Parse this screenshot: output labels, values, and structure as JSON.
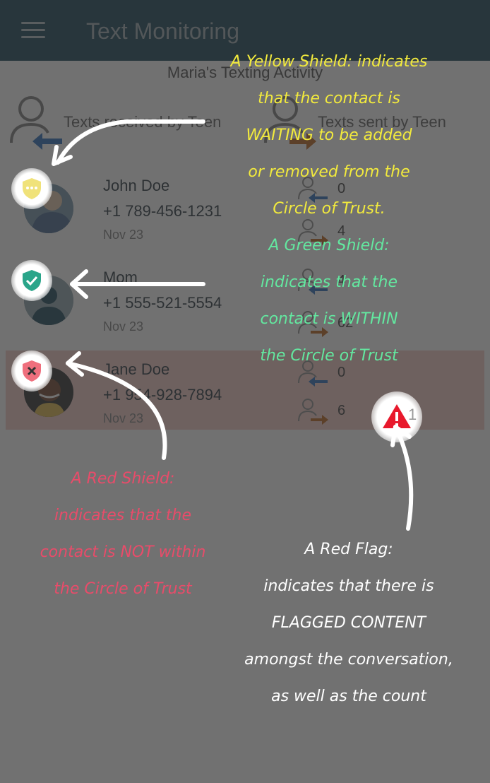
{
  "app": {
    "title": "Text Monitoring",
    "menu_icon": "hamburger-menu-icon"
  },
  "subtitle": "Maria's Texting Activity",
  "columns": {
    "received": "Texts received by Teen",
    "sent": "Texts sent by Teen"
  },
  "contacts": [
    {
      "name": "John Doe",
      "phone": "+1 789-456-1231",
      "date": "Nov 23",
      "shield": "yellow",
      "received": "0",
      "sent": "4"
    },
    {
      "name": "Mom",
      "phone": "+1 555-521-5554",
      "date": "Nov 23",
      "shield": "green",
      "received": "4",
      "sent": "62"
    },
    {
      "name": "Jane Doe",
      "phone": "+1 954-928-7894",
      "date": "Nov 23",
      "shield": "red",
      "received": "0",
      "sent": "6",
      "flag_count": "1"
    }
  ],
  "colors": {
    "appbar": "#0b3b4f",
    "shield_yellow": "#f0e27a",
    "shield_green": "#2aa58a",
    "shield_red": "#ef6f7d",
    "flag_red": "#e8192c",
    "received_arrow": "#1e67b7",
    "sent_arrow": "#b95a10"
  },
  "annotations": {
    "yellow": [
      "A Yellow Shield: indicates",
      "that the contact is",
      "WAITING to be added",
      "or removed from the",
      "Circle of Trust."
    ],
    "green": [
      "A Green Shield:",
      "indicates that the",
      "contact is WITHIN",
      "the Circle of Trust"
    ],
    "red": [
      "A Red Shield:",
      "indicates that the",
      "contact is NOT within",
      "the Circle of Trust"
    ],
    "flag": [
      "A Red Flag:",
      "indicates that there is",
      "FLAGGED CONTENT",
      "amongst the conversation,",
      "as well as the count"
    ]
  }
}
